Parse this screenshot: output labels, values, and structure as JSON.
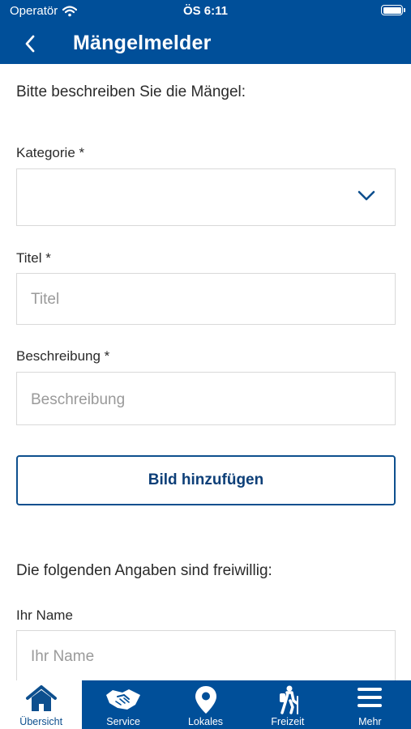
{
  "status_bar": {
    "carrier": "Operatör",
    "time": "ÖS 6:11"
  },
  "header": {
    "title": "Mängelmelder"
  },
  "form": {
    "intro": "Bitte beschreiben Sie die Mängel:",
    "category_label": "Kategorie *",
    "category_value": "",
    "title_label": "Titel *",
    "title_placeholder": "Titel",
    "description_label": "Beschreibung *",
    "description_placeholder": "Beschreibung",
    "add_image_label": "Bild hinzufügen",
    "optional_heading": "Die folgenden Angaben sind freiwillig:",
    "name_label": "Ihr Name",
    "name_placeholder": "Ihr Name"
  },
  "tabbar": {
    "items": [
      {
        "label": "Übersicht",
        "icon": "home-icon",
        "active": true
      },
      {
        "label": "Service",
        "icon": "handshake-icon",
        "active": false
      },
      {
        "label": "Lokales",
        "icon": "location-pin-icon",
        "active": false
      },
      {
        "label": "Freizeit",
        "icon": "hiker-icon",
        "active": false
      },
      {
        "label": "Mehr",
        "icon": "menu-icon",
        "active": false
      }
    ]
  },
  "colors": {
    "brand_blue": "#004f99",
    "button_text": "#0d3f78",
    "placeholder": "#9a9a9a"
  }
}
